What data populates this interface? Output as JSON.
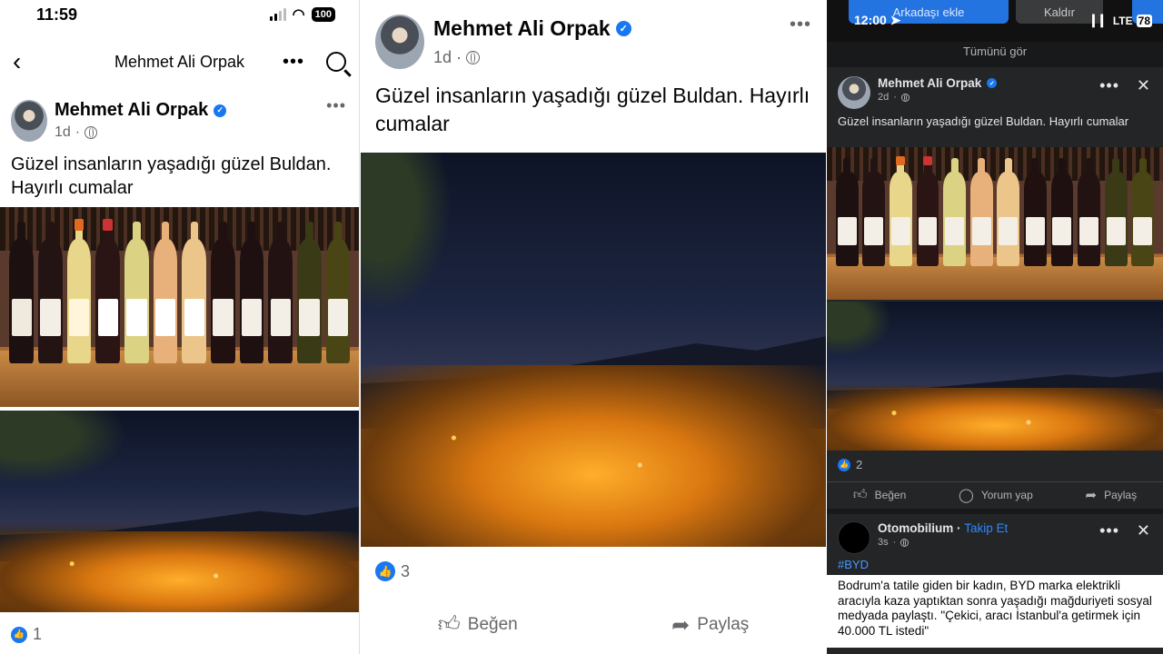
{
  "panel1": {
    "status": {
      "time": "11:59",
      "battery": "100"
    },
    "nav": {
      "title": "Mehmet Ali Orpak"
    },
    "post": {
      "author": "Mehmet Ali Orpak",
      "time": "1d",
      "text": "Güzel  insanların yaşadığı güzel Buldan. Hayırlı cumalar",
      "reaction_count": "1"
    }
  },
  "panel2": {
    "post": {
      "author": "Mehmet Ali Orpak",
      "time": "1d",
      "text": "Güzel insanların yaşadığı güzel Buldan. Hayırlı cumalar",
      "reaction_count": "3",
      "like_label": "Beğen",
      "share_label": "Paylaş"
    }
  },
  "panel3": {
    "status": {
      "time": "12:00",
      "network": "LTE",
      "battery": "78"
    },
    "top_buttons": {
      "add_friend": "Arkadaşı ekle",
      "remove": "Kaldır"
    },
    "see_all": "Tümünü gör",
    "post": {
      "author": "Mehmet Ali Orpak",
      "time": "2d",
      "text": "Güzel  insanların yaşadığı güzel Buldan. Hayırlı cumalar",
      "reaction_count": "2",
      "like_label": "Beğen",
      "comment_label": "Yorum yap",
      "share_label": "Paylaş"
    },
    "next_post": {
      "author": "Otomobilium",
      "separator": "·",
      "follow_label": "Takip Et",
      "time": "3s",
      "hashtag": "#BYD",
      "text": "Bodrum'a tatile giden bir kadın, BYD marka elektrikli aracıyla kaza yaptıktan sonra yaşadığı mağduriyeti sosyal medyada paylaştı. \"Çekici, aracı İstanbul'a getirmek için 40.000 TL istedi\""
    }
  },
  "colors": {
    "facebook_blue": "#1877f2",
    "dark_bg": "#242526",
    "link_blue": "#2d88ff"
  },
  "icons": [
    "back-arrow-icon",
    "more-icon",
    "search-icon",
    "verified-icon",
    "globe-icon",
    "like-icon",
    "share-icon",
    "comment-icon",
    "close-icon",
    "location-icon"
  ]
}
